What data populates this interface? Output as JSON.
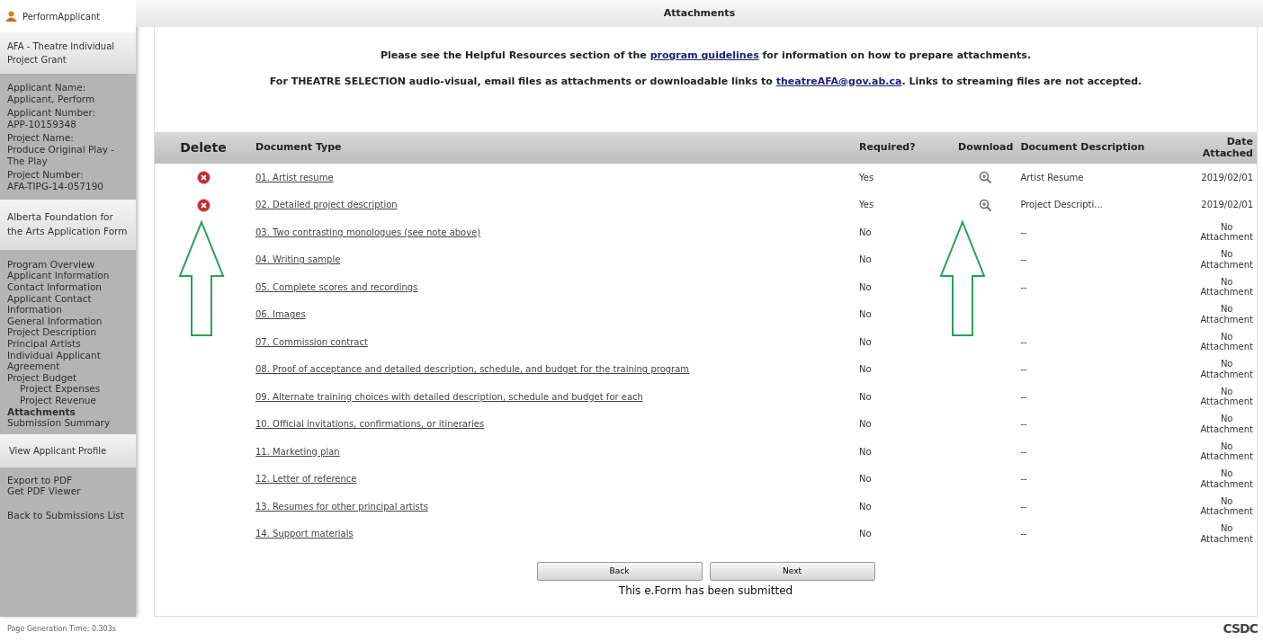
{
  "sidebar": {
    "user": "PerformApplicant",
    "program": "AFA - Theatre Individual Project Grant",
    "details": [
      {
        "label": "Applicant Name:",
        "value": "Applicant, Perform"
      },
      {
        "label": "Applicant Number:",
        "value": "APP-10159348"
      },
      {
        "label": "Project Name:",
        "value": "Produce Original Play - The Play"
      },
      {
        "label": "Project Number:",
        "value": "AFA-TIPG-14-057190"
      }
    ],
    "form_title": "Alberta Foundation for the Arts Application Form",
    "nav": [
      {
        "label": "Program Overview",
        "selected": false
      },
      {
        "label": "Applicant Information",
        "selected": false
      },
      {
        "label": "Contact Information",
        "selected": false
      },
      {
        "label": "Applicant Contact Information",
        "selected": false
      },
      {
        "label": "General Information",
        "selected": false
      },
      {
        "label": "Project Description",
        "selected": false
      },
      {
        "label": "Principal Artists",
        "selected": false
      },
      {
        "label": "Individual Applicant Agreement",
        "selected": false
      },
      {
        "label": "Project Budget",
        "selected": false,
        "children": [
          {
            "label": "Project Expenses",
            "selected": false
          },
          {
            "label": "Project Revenue",
            "selected": false
          }
        ]
      },
      {
        "label": "Attachments",
        "selected": true
      },
      {
        "label": "Submission Summary",
        "selected": false
      }
    ],
    "profile_link": "View Applicant Profile",
    "export_links": [
      "Export to PDF",
      "Get PDF Viewer"
    ],
    "back_link": "Back to Submissions List"
  },
  "footer": {
    "generation_time": "Page Generation Time: 0.303s",
    "logo": "CSDC"
  },
  "main": {
    "title": "Attachments",
    "notes": [
      {
        "before": "Please see the Helpful Resources section of the ",
        "link": "program guidelines",
        "after": " for information on how to prepare attachments."
      },
      {
        "before": "For THEATRE SELECTION audio-visual, email files as attachments or downloadable links to ",
        "link": "theatreAFA@gov.ab.ca",
        "after": ". Links to streaming files are not accepted."
      }
    ],
    "table": {
      "columns": [
        "Delete",
        "Document Type",
        "Required?",
        "Download",
        "Document Description",
        "Date Attached"
      ],
      "rows": [
        {
          "deletable": true,
          "type": "01. Artist resume",
          "required": "Yes",
          "downloadable": true,
          "description": "Artist Resume",
          "date": "2019/02/01"
        },
        {
          "deletable": true,
          "type": "02. Detailed project description",
          "required": "Yes",
          "downloadable": true,
          "description": "Project Descripti...",
          "date": "2019/02/01"
        },
        {
          "deletable": false,
          "type": "03. Two contrasting monologues (see note above)",
          "required": "No",
          "downloadable": false,
          "description": "--",
          "date": "No Attachment"
        },
        {
          "deletable": false,
          "type": "04. Writing sample",
          "required": "No",
          "downloadable": false,
          "description": "--",
          "date": "No Attachment"
        },
        {
          "deletable": false,
          "type": "05. Complete scores and recordings",
          "required": "No",
          "downloadable": false,
          "description": "--",
          "date": "No Attachment"
        },
        {
          "deletable": false,
          "type": "06. Images",
          "required": "No",
          "downloadable": false,
          "date": "No Attachment"
        },
        {
          "deletable": false,
          "type": "07. Commission contract",
          "required": "No",
          "downloadable": false,
          "description": "--",
          "date": "No Attachment"
        },
        {
          "deletable": false,
          "type": "08. Proof of acceptance and detailed description, schedule, and budget for the training program",
          "required": "No",
          "downloadable": false,
          "description": "--",
          "date": "No Attachment"
        },
        {
          "deletable": false,
          "type": "09. Alternate training choices with detailed description, schedule and budget for each",
          "required": "No",
          "downloadable": false,
          "description": "--",
          "date": "No Attachment"
        },
        {
          "deletable": false,
          "type": "10. Official invitations, confirmations, or itineraries",
          "required": "No",
          "downloadable": false,
          "description": "--",
          "date": "No Attachment"
        },
        {
          "deletable": false,
          "type": "11. Marketing plan",
          "required": "No",
          "downloadable": false,
          "description": "--",
          "date": "No Attachment"
        },
        {
          "deletable": false,
          "type": "12. Letter of reference",
          "required": "No",
          "downloadable": false,
          "description": "--",
          "date": "No Attachment"
        },
        {
          "deletable": false,
          "type": "13. Resumes for other principal artists",
          "required": "No",
          "downloadable": false,
          "description": "--",
          "date": "No Attachment"
        },
        {
          "deletable": false,
          "type": "14. Support materials",
          "required": "No",
          "downloadable": false,
          "description": "--",
          "date": "No Attachment"
        }
      ]
    },
    "buttons": [
      "Back",
      "Next"
    ],
    "status": "This e.Form has been submitted"
  }
}
